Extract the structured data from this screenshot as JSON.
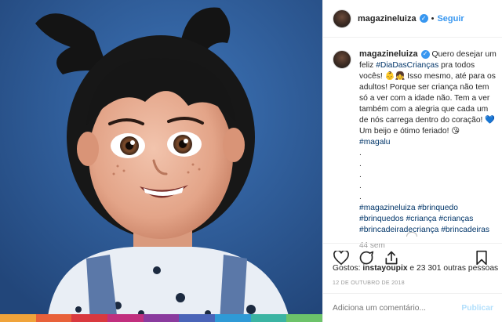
{
  "header": {
    "username": "magazineluiza",
    "verified_icon": "verified-badge-icon",
    "separator": "•",
    "follow_label": "Seguir"
  },
  "caption": {
    "username": "magazineluiza",
    "text_1": " Quero desejar um feliz ",
    "hashtag_dia": "#DiaDasCrianças",
    "text_2": " pra todos vocês! 👶👧 Isso mesmo, até para os adultos! Porque ser criança não tem só a ver com a idade não. Tem a ver também com a alegria que cada um de nós carrega dentro do coração! 💙 Um beijo e ótimo feriado! 😘",
    "hashtag_magalu": "#magalu",
    "dot_lines": [
      ".",
      ".",
      ".",
      ".",
      "."
    ],
    "hashtags": [
      "#magazineluiza",
      "#brinquedo",
      "#brinquedos",
      "#criança",
      "#crianças",
      "#brincadeiradecriança",
      "#brincadeiras"
    ],
    "time_ago": "44 sem"
  },
  "actions": {
    "icons": [
      "heart-icon",
      "comment-icon",
      "share-icon",
      "bookmark-icon"
    ]
  },
  "likes": {
    "prefix": "Gostos: ",
    "user": "instayoupix",
    "suffix": " e 23 301 outras pessoas"
  },
  "date": "12 DE OUTUBRO DE 2018",
  "comment": {
    "placeholder": "Adiciona um comentário...",
    "publish_label": "Publicar"
  },
  "colors": {
    "background_blue": "#2d5d9b",
    "link_blue": "#3897f0",
    "hashtag_blue": "#003569",
    "rainbow": [
      "#f0a33a",
      "#e8613a",
      "#d9393f",
      "#c12f7e",
      "#8a3b9e",
      "#4a64b8",
      "#2f9ad6",
      "#3bb4a3",
      "#6cc36a"
    ]
  }
}
